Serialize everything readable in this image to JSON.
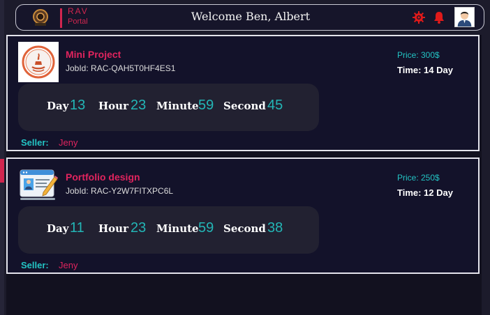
{
  "header": {
    "brand_top": "RAV",
    "brand_bottom": "Portal",
    "welcome": "Welcome Ben, Albert",
    "accent_color": "#d1264f"
  },
  "icons": {
    "logo": "emblem-logo-icon",
    "settings": "gear-icon",
    "notifications": "bell-icon",
    "avatar": "user-avatar-icon"
  },
  "jobs": [
    {
      "title": "Mini Project",
      "job_id": "JobId: RAC-QAH5T0HF4ES1",
      "price": "Price: 300$",
      "time": "Time: 14 Day",
      "thumbnail": "java-logo-icon",
      "timer": {
        "day_label": "Day",
        "day": "13",
        "hour_label": "Hour",
        "hour": "23",
        "minute_label": "Minute",
        "minute": "59",
        "second_label": "Second",
        "second": "45"
      },
      "seller_label": "Seller:",
      "seller": "Jeny"
    },
    {
      "title": "Portfolio design",
      "job_id": "JobId: RAC-Y2W7FITXPC6L",
      "price": "Price: 250$",
      "time": "Time: 12 Day",
      "thumbnail": "id-card-edit-icon",
      "timer": {
        "day_label": "Day",
        "day": "11",
        "hour_label": "Hour",
        "hour": "23",
        "minute_label": "Minute",
        "minute": "59",
        "second_label": "Second",
        "second": "38"
      },
      "seller_label": "Seller:",
      "seller": "Jeny"
    }
  ]
}
